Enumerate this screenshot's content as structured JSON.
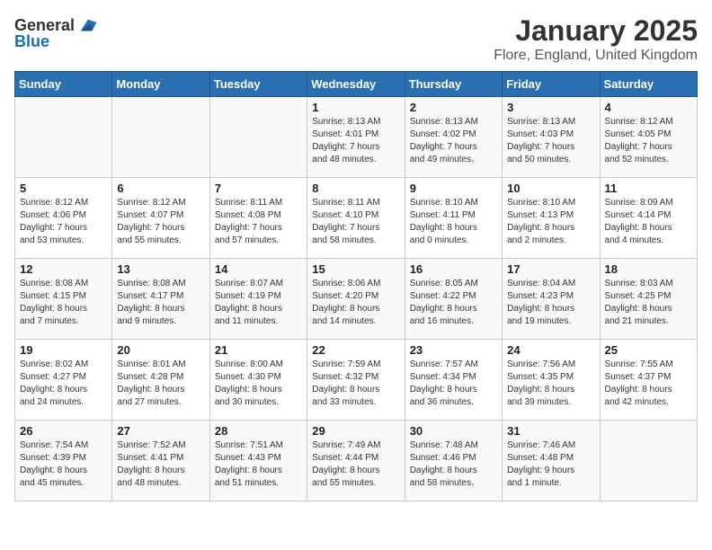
{
  "header": {
    "logo_general": "General",
    "logo_blue": "Blue",
    "title": "January 2025",
    "location": "Flore, England, United Kingdom"
  },
  "weekdays": [
    "Sunday",
    "Monday",
    "Tuesday",
    "Wednesday",
    "Thursday",
    "Friday",
    "Saturday"
  ],
  "weeks": [
    [
      {
        "day": "",
        "info": ""
      },
      {
        "day": "",
        "info": ""
      },
      {
        "day": "",
        "info": ""
      },
      {
        "day": "1",
        "info": "Sunrise: 8:13 AM\nSunset: 4:01 PM\nDaylight: 7 hours\nand 48 minutes."
      },
      {
        "day": "2",
        "info": "Sunrise: 8:13 AM\nSunset: 4:02 PM\nDaylight: 7 hours\nand 49 minutes."
      },
      {
        "day": "3",
        "info": "Sunrise: 8:13 AM\nSunset: 4:03 PM\nDaylight: 7 hours\nand 50 minutes."
      },
      {
        "day": "4",
        "info": "Sunrise: 8:12 AM\nSunset: 4:05 PM\nDaylight: 7 hours\nand 52 minutes."
      }
    ],
    [
      {
        "day": "5",
        "info": "Sunrise: 8:12 AM\nSunset: 4:06 PM\nDaylight: 7 hours\nand 53 minutes."
      },
      {
        "day": "6",
        "info": "Sunrise: 8:12 AM\nSunset: 4:07 PM\nDaylight: 7 hours\nand 55 minutes."
      },
      {
        "day": "7",
        "info": "Sunrise: 8:11 AM\nSunset: 4:08 PM\nDaylight: 7 hours\nand 57 minutes."
      },
      {
        "day": "8",
        "info": "Sunrise: 8:11 AM\nSunset: 4:10 PM\nDaylight: 7 hours\nand 58 minutes."
      },
      {
        "day": "9",
        "info": "Sunrise: 8:10 AM\nSunset: 4:11 PM\nDaylight: 8 hours\nand 0 minutes."
      },
      {
        "day": "10",
        "info": "Sunrise: 8:10 AM\nSunset: 4:13 PM\nDaylight: 8 hours\nand 2 minutes."
      },
      {
        "day": "11",
        "info": "Sunrise: 8:09 AM\nSunset: 4:14 PM\nDaylight: 8 hours\nand 4 minutes."
      }
    ],
    [
      {
        "day": "12",
        "info": "Sunrise: 8:08 AM\nSunset: 4:15 PM\nDaylight: 8 hours\nand 7 minutes."
      },
      {
        "day": "13",
        "info": "Sunrise: 8:08 AM\nSunset: 4:17 PM\nDaylight: 8 hours\nand 9 minutes."
      },
      {
        "day": "14",
        "info": "Sunrise: 8:07 AM\nSunset: 4:19 PM\nDaylight: 8 hours\nand 11 minutes."
      },
      {
        "day": "15",
        "info": "Sunrise: 8:06 AM\nSunset: 4:20 PM\nDaylight: 8 hours\nand 14 minutes."
      },
      {
        "day": "16",
        "info": "Sunrise: 8:05 AM\nSunset: 4:22 PM\nDaylight: 8 hours\nand 16 minutes."
      },
      {
        "day": "17",
        "info": "Sunrise: 8:04 AM\nSunset: 4:23 PM\nDaylight: 8 hours\nand 19 minutes."
      },
      {
        "day": "18",
        "info": "Sunrise: 8:03 AM\nSunset: 4:25 PM\nDaylight: 8 hours\nand 21 minutes."
      }
    ],
    [
      {
        "day": "19",
        "info": "Sunrise: 8:02 AM\nSunset: 4:27 PM\nDaylight: 8 hours\nand 24 minutes."
      },
      {
        "day": "20",
        "info": "Sunrise: 8:01 AM\nSunset: 4:28 PM\nDaylight: 8 hours\nand 27 minutes."
      },
      {
        "day": "21",
        "info": "Sunrise: 8:00 AM\nSunset: 4:30 PM\nDaylight: 8 hours\nand 30 minutes."
      },
      {
        "day": "22",
        "info": "Sunrise: 7:59 AM\nSunset: 4:32 PM\nDaylight: 8 hours\nand 33 minutes."
      },
      {
        "day": "23",
        "info": "Sunrise: 7:57 AM\nSunset: 4:34 PM\nDaylight: 8 hours\nand 36 minutes."
      },
      {
        "day": "24",
        "info": "Sunrise: 7:56 AM\nSunset: 4:35 PM\nDaylight: 8 hours\nand 39 minutes."
      },
      {
        "day": "25",
        "info": "Sunrise: 7:55 AM\nSunset: 4:37 PM\nDaylight: 8 hours\nand 42 minutes."
      }
    ],
    [
      {
        "day": "26",
        "info": "Sunrise: 7:54 AM\nSunset: 4:39 PM\nDaylight: 8 hours\nand 45 minutes."
      },
      {
        "day": "27",
        "info": "Sunrise: 7:52 AM\nSunset: 4:41 PM\nDaylight: 8 hours\nand 48 minutes."
      },
      {
        "day": "28",
        "info": "Sunrise: 7:51 AM\nSunset: 4:43 PM\nDaylight: 8 hours\nand 51 minutes."
      },
      {
        "day": "29",
        "info": "Sunrise: 7:49 AM\nSunset: 4:44 PM\nDaylight: 8 hours\nand 55 minutes."
      },
      {
        "day": "30",
        "info": "Sunrise: 7:48 AM\nSunset: 4:46 PM\nDaylight: 8 hours\nand 58 minutes."
      },
      {
        "day": "31",
        "info": "Sunrise: 7:46 AM\nSunset: 4:48 PM\nDaylight: 9 hours\nand 1 minute."
      },
      {
        "day": "",
        "info": ""
      }
    ]
  ]
}
